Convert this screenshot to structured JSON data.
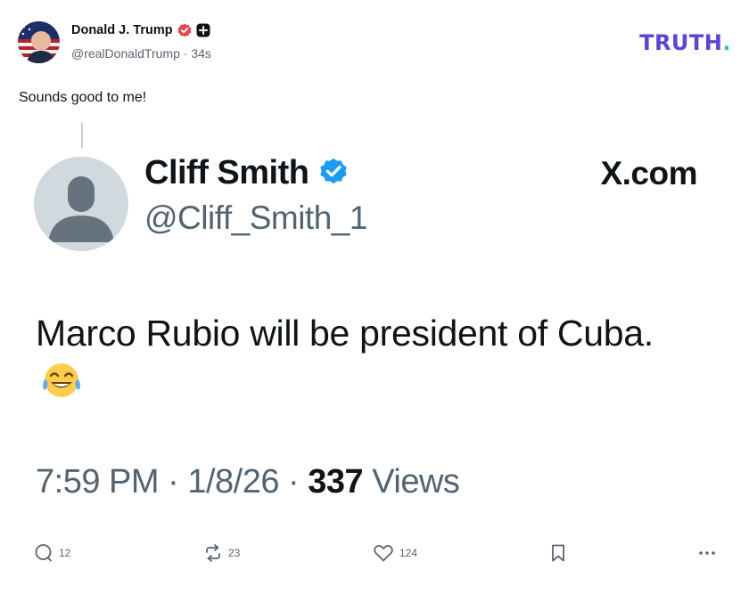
{
  "header": {
    "author_name": "Donald J. Trump",
    "handle": "@realDonaldTrump",
    "separator": "·",
    "time_ago": "34s",
    "logo_text": "TRUTH",
    "logo_dot": ".",
    "badge_icons": [
      "verified-badge-icon",
      "plus-badge-icon"
    ]
  },
  "post": {
    "text": "Sounds good to me!"
  },
  "embedded_tweet": {
    "name": "Cliff Smith",
    "handle": "@Cliff_Smith_1",
    "source": "X.com",
    "body": "Marco Rubio will be president of Cuba.",
    "emoji": "face-with-tears-of-joy-emoji",
    "time": "7:59 PM",
    "date": "1/8/26",
    "views_count": "337",
    "views_label": "Views"
  },
  "actions": {
    "replies": "12",
    "retruths": "23",
    "likes": "124"
  },
  "colors": {
    "truth_purple": "#5a45d6",
    "truth_teal": "#21c7c9",
    "x_verified_blue": "#1d9bf0",
    "text_secondary": "#536471"
  }
}
